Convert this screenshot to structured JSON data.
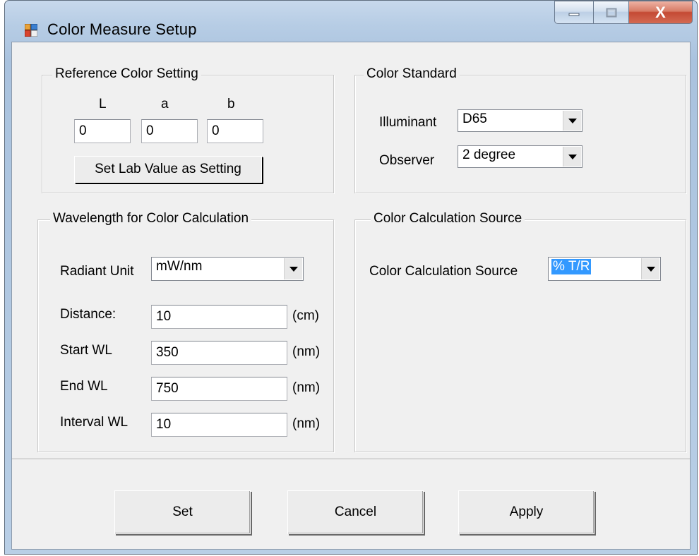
{
  "window": {
    "title": "Color Measure Setup",
    "icon": "app-window-icon",
    "controls": {
      "minimize": "minimize-icon",
      "maximize": "maximize-icon",
      "close_label": "X"
    }
  },
  "reference": {
    "legend": "Reference Color Setting",
    "labels": {
      "L": "L",
      "a": "a",
      "b": "b"
    },
    "values": {
      "L": "0",
      "a": "0",
      "b": "0"
    },
    "set_button": "Set Lab Value as Setting"
  },
  "standard": {
    "legend": "Color Standard",
    "illuminant_label": "Illuminant",
    "illuminant_value": "D65",
    "observer_label": "Observer",
    "observer_value": "2 degree"
  },
  "wavelength": {
    "legend": "Wavelength for Color Calculation",
    "radiant_label": "Radiant Unit",
    "radiant_value": "mW/nm",
    "distance_label": "Distance:",
    "distance_value": "10",
    "distance_unit": "(cm)",
    "start_label": "Start WL",
    "start_value": "350",
    "start_unit": "(nm)",
    "end_label": "End WL",
    "end_value": "750",
    "end_unit": "(nm)",
    "interval_label": "Interval WL",
    "interval_value": "10",
    "interval_unit": "(nm)"
  },
  "source": {
    "legend": "Color Calculation Source",
    "label": "Color Calculation Source",
    "value": "% T/R"
  },
  "buttons": {
    "set": "Set",
    "cancel": "Cancel",
    "apply": "Apply"
  }
}
